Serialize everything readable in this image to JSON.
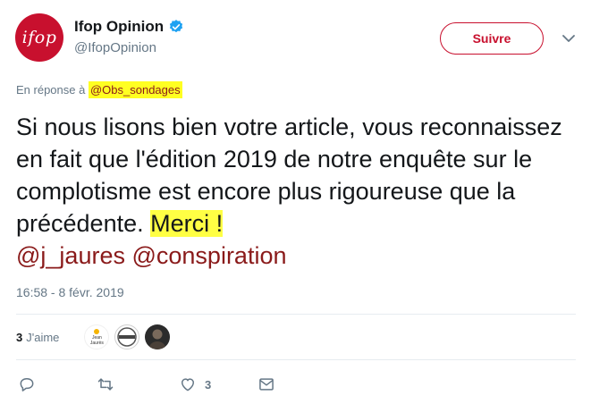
{
  "author": {
    "display_name": "Ifop Opinion",
    "handle": "@IfopOpinion",
    "avatar_text": "ifop",
    "verified": true
  },
  "follow_button": {
    "label": "Suivre"
  },
  "reply_context": {
    "prefix": "En réponse à",
    "mention": "@Obs_sondages"
  },
  "tweet": {
    "text_main": "Si nous lisons bien votre article, vous reconnaissez en fait que l'édition 2019 de notre enquête sur le complotisme est encore plus rigoureuse que la précédente. ",
    "text_highlight": "Merci !",
    "mentions": [
      "@j_jaures",
      "@conspiration"
    ],
    "timestamp": "16:58 - 8 févr. 2019"
  },
  "engagement": {
    "likes_count": "3",
    "likes_label": "J'aime",
    "liker_1_text": "Jean Jaurès"
  },
  "actions": {
    "like_count": "3"
  },
  "colors": {
    "brand": "#c8102e",
    "mention": "#8a1a1a",
    "highlight": "#ffff44",
    "muted": "#657786",
    "verified": "#1da1f2"
  },
  "icons": [
    "verified-badge-icon",
    "chevron-down-icon",
    "reply-icon",
    "retweet-icon",
    "heart-icon",
    "direct-message-icon"
  ]
}
